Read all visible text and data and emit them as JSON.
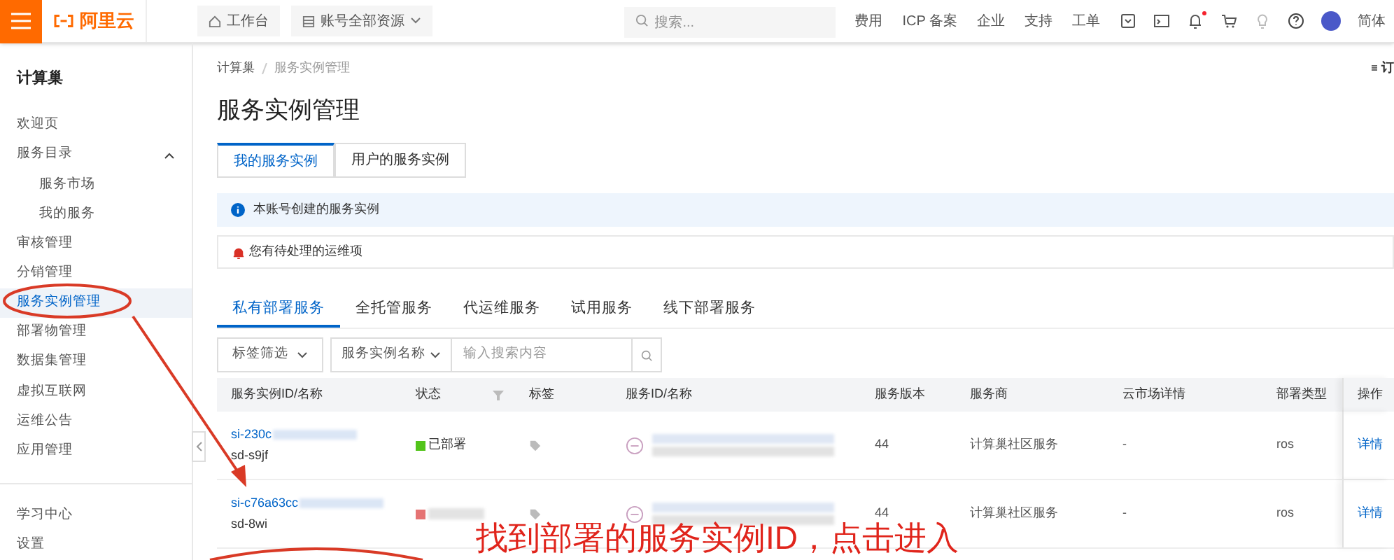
{
  "topbar": {
    "logo": "阿里云",
    "workbench": "工作台",
    "resources": "账号全部资源",
    "search": {
      "placeholder": "搜索..."
    },
    "links": [
      "费用",
      "ICP 备案",
      "企业",
      "支持",
      "工单"
    ],
    "notification_dot": true,
    "language": "简体"
  },
  "sidebar": {
    "title": "计算巢",
    "items": [
      {
        "label": "欢迎页",
        "selected": false
      },
      {
        "label": "服务目录",
        "selected": false,
        "expanded": true,
        "children": [
          {
            "label": "服务市场",
            "selected": false
          },
          {
            "label": "我的服务",
            "selected": false
          }
        ]
      },
      {
        "label": "审核管理",
        "selected": false
      },
      {
        "label": "分销管理",
        "selected": false
      },
      {
        "label": "服务实例管理",
        "selected": true
      },
      {
        "label": "部署物管理",
        "selected": false
      },
      {
        "label": "数据集管理",
        "selected": false
      },
      {
        "label": "虚拟互联网",
        "selected": false
      },
      {
        "label": "运维公告",
        "selected": false
      },
      {
        "label": "应用管理",
        "selected": false
      }
    ],
    "footer_items": [
      "学习中心",
      "设置"
    ]
  },
  "breadcrumb": [
    "计算巢",
    "服务实例管理"
  ],
  "corner_label": "订",
  "title": "服务实例管理",
  "tabs": [
    {
      "label": "我的服务实例",
      "selected": true
    },
    {
      "label": "用户的服务实例",
      "selected": false
    }
  ],
  "info": "本账号创建的服务实例",
  "alert": "您有待处理的运维项",
  "subtabs": [
    {
      "label": "私有部署服务",
      "selected": true
    },
    {
      "label": "全托管服务",
      "selected": false
    },
    {
      "label": "代运维服务",
      "selected": false
    },
    {
      "label": "试用服务",
      "selected": false
    },
    {
      "label": "线下部署服务",
      "selected": false
    }
  ],
  "filters": {
    "tag_filter": "标签筛选",
    "field": "服务实例名称",
    "placeholder": "输入搜索内容"
  },
  "table": {
    "columns": [
      "服务实例ID/名称",
      "状态",
      "标签",
      "服务ID/名称",
      "服务版本",
      "服务商",
      "云市场详情",
      "部署类型",
      "操作"
    ],
    "rows": [
      {
        "id": "si-230c",
        "name": "sd-s9jf",
        "status": "已部署",
        "color": "#52c41a",
        "version": "44",
        "provider": "计算巢社区服务",
        "market": "-",
        "deploy_type": "ros",
        "action": "详情"
      },
      {
        "id": "si-c76a63cc",
        "name": "sd-8wi",
        "status": "",
        "color": "#e57373",
        "version": "44",
        "provider": "计算巢社区服务",
        "market": "-",
        "deploy_type": "ros",
        "action": "详情"
      }
    ]
  },
  "annotation": "找到部署的服务实例ID，点击进入"
}
